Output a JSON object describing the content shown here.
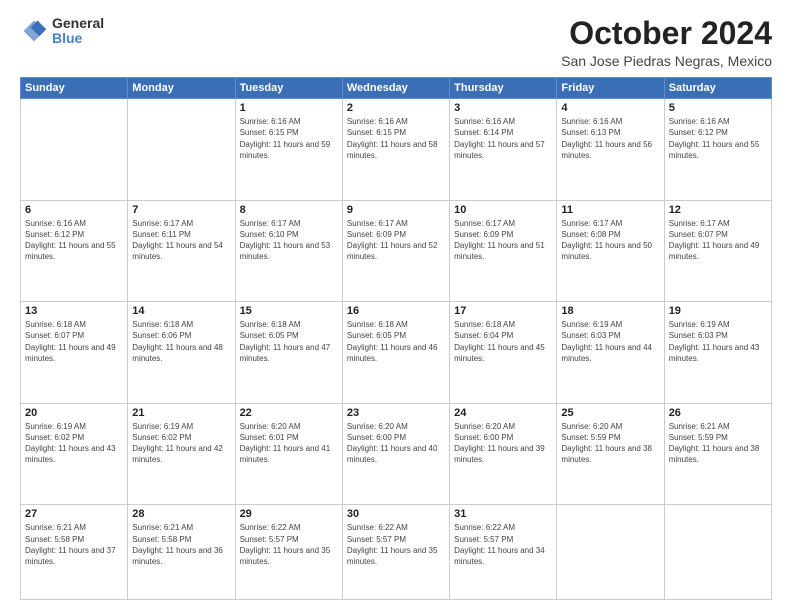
{
  "header": {
    "logo_general": "General",
    "logo_blue": "Blue",
    "month_title": "October 2024",
    "location": "San Jose Piedras Negras, Mexico"
  },
  "weekdays": [
    "Sunday",
    "Monday",
    "Tuesday",
    "Wednesday",
    "Thursday",
    "Friday",
    "Saturday"
  ],
  "weeks": [
    [
      {
        "day": "",
        "info": ""
      },
      {
        "day": "",
        "info": ""
      },
      {
        "day": "1",
        "info": "Sunrise: 6:16 AM\nSunset: 6:15 PM\nDaylight: 11 hours and 59 minutes."
      },
      {
        "day": "2",
        "info": "Sunrise: 6:16 AM\nSunset: 6:15 PM\nDaylight: 11 hours and 58 minutes."
      },
      {
        "day": "3",
        "info": "Sunrise: 6:16 AM\nSunset: 6:14 PM\nDaylight: 11 hours and 57 minutes."
      },
      {
        "day": "4",
        "info": "Sunrise: 6:16 AM\nSunset: 6:13 PM\nDaylight: 11 hours and 56 minutes."
      },
      {
        "day": "5",
        "info": "Sunrise: 6:16 AM\nSunset: 6:12 PM\nDaylight: 11 hours and 55 minutes."
      }
    ],
    [
      {
        "day": "6",
        "info": "Sunrise: 6:16 AM\nSunset: 6:12 PM\nDaylight: 11 hours and 55 minutes."
      },
      {
        "day": "7",
        "info": "Sunrise: 6:17 AM\nSunset: 6:11 PM\nDaylight: 11 hours and 54 minutes."
      },
      {
        "day": "8",
        "info": "Sunrise: 6:17 AM\nSunset: 6:10 PM\nDaylight: 11 hours and 53 minutes."
      },
      {
        "day": "9",
        "info": "Sunrise: 6:17 AM\nSunset: 6:09 PM\nDaylight: 11 hours and 52 minutes."
      },
      {
        "day": "10",
        "info": "Sunrise: 6:17 AM\nSunset: 6:09 PM\nDaylight: 11 hours and 51 minutes."
      },
      {
        "day": "11",
        "info": "Sunrise: 6:17 AM\nSunset: 6:08 PM\nDaylight: 11 hours and 50 minutes."
      },
      {
        "day": "12",
        "info": "Sunrise: 6:17 AM\nSunset: 6:07 PM\nDaylight: 11 hours and 49 minutes."
      }
    ],
    [
      {
        "day": "13",
        "info": "Sunrise: 6:18 AM\nSunset: 6:07 PM\nDaylight: 11 hours and 49 minutes."
      },
      {
        "day": "14",
        "info": "Sunrise: 6:18 AM\nSunset: 6:06 PM\nDaylight: 11 hours and 48 minutes."
      },
      {
        "day": "15",
        "info": "Sunrise: 6:18 AM\nSunset: 6:05 PM\nDaylight: 11 hours and 47 minutes."
      },
      {
        "day": "16",
        "info": "Sunrise: 6:18 AM\nSunset: 6:05 PM\nDaylight: 11 hours and 46 minutes."
      },
      {
        "day": "17",
        "info": "Sunrise: 6:18 AM\nSunset: 6:04 PM\nDaylight: 11 hours and 45 minutes."
      },
      {
        "day": "18",
        "info": "Sunrise: 6:19 AM\nSunset: 6:03 PM\nDaylight: 11 hours and 44 minutes."
      },
      {
        "day": "19",
        "info": "Sunrise: 6:19 AM\nSunset: 6:03 PM\nDaylight: 11 hours and 43 minutes."
      }
    ],
    [
      {
        "day": "20",
        "info": "Sunrise: 6:19 AM\nSunset: 6:02 PM\nDaylight: 11 hours and 43 minutes."
      },
      {
        "day": "21",
        "info": "Sunrise: 6:19 AM\nSunset: 6:02 PM\nDaylight: 11 hours and 42 minutes."
      },
      {
        "day": "22",
        "info": "Sunrise: 6:20 AM\nSunset: 6:01 PM\nDaylight: 11 hours and 41 minutes."
      },
      {
        "day": "23",
        "info": "Sunrise: 6:20 AM\nSunset: 6:00 PM\nDaylight: 11 hours and 40 minutes."
      },
      {
        "day": "24",
        "info": "Sunrise: 6:20 AM\nSunset: 6:00 PM\nDaylight: 11 hours and 39 minutes."
      },
      {
        "day": "25",
        "info": "Sunrise: 6:20 AM\nSunset: 5:59 PM\nDaylight: 11 hours and 38 minutes."
      },
      {
        "day": "26",
        "info": "Sunrise: 6:21 AM\nSunset: 5:59 PM\nDaylight: 11 hours and 38 minutes."
      }
    ],
    [
      {
        "day": "27",
        "info": "Sunrise: 6:21 AM\nSunset: 5:58 PM\nDaylight: 11 hours and 37 minutes."
      },
      {
        "day": "28",
        "info": "Sunrise: 6:21 AM\nSunset: 5:58 PM\nDaylight: 11 hours and 36 minutes."
      },
      {
        "day": "29",
        "info": "Sunrise: 6:22 AM\nSunset: 5:57 PM\nDaylight: 11 hours and 35 minutes."
      },
      {
        "day": "30",
        "info": "Sunrise: 6:22 AM\nSunset: 5:57 PM\nDaylight: 11 hours and 35 minutes."
      },
      {
        "day": "31",
        "info": "Sunrise: 6:22 AM\nSunset: 5:57 PM\nDaylight: 11 hours and 34 minutes."
      },
      {
        "day": "",
        "info": ""
      },
      {
        "day": "",
        "info": ""
      }
    ]
  ]
}
